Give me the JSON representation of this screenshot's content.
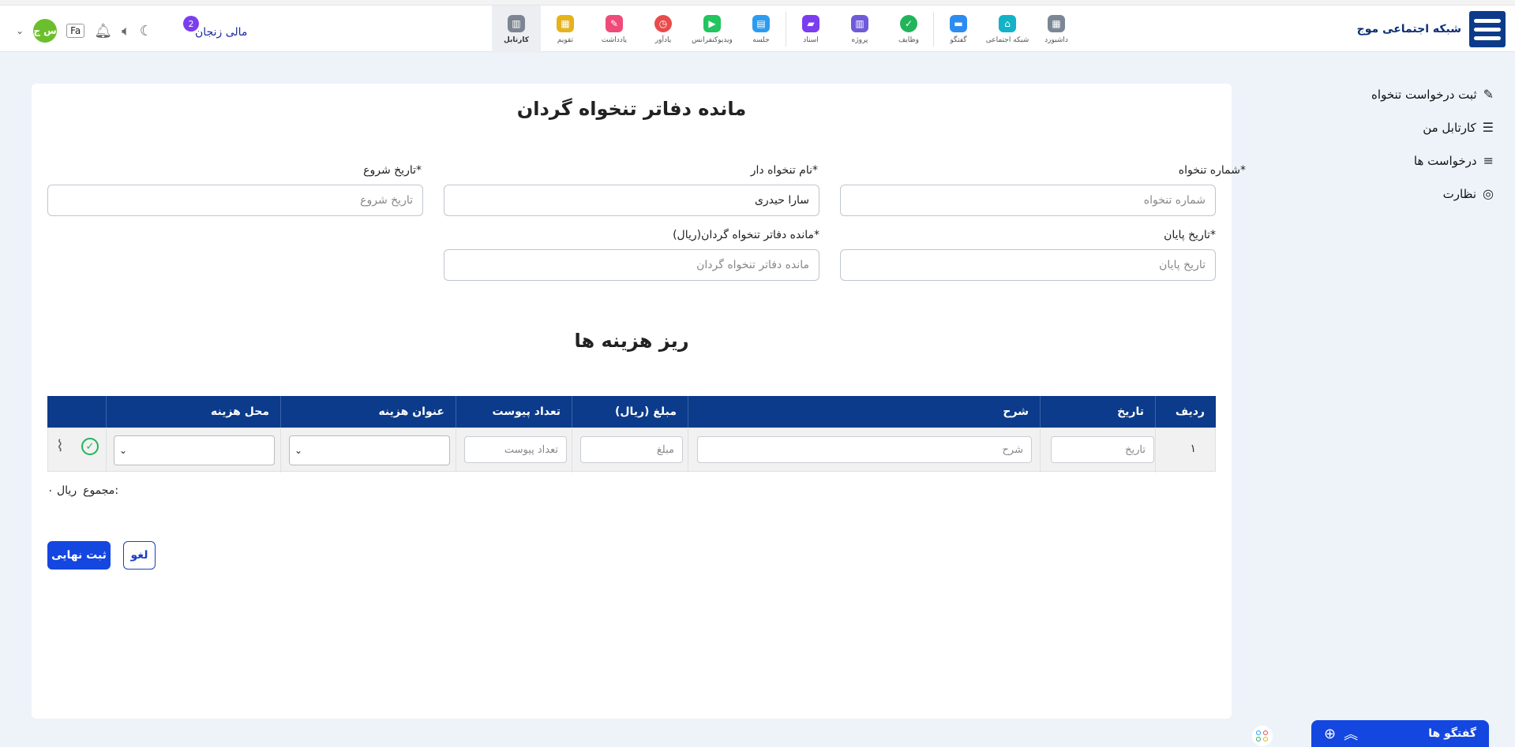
{
  "header": {
    "brand_name": "شبکه اجتماعی موج",
    "username": "مالی زنجان",
    "badge_count": "2",
    "avatar_initials": "س ج",
    "lang": "Fa",
    "apps": [
      {
        "label": "داشبورد",
        "color": "#7b8794"
      },
      {
        "label": "شبکه اجتماعی",
        "color": "#12b3c7"
      },
      {
        "label": "گفتگو",
        "color": "#2d8cf0"
      },
      {
        "label": "وظایف",
        "color": "#22b45a"
      },
      {
        "label": "پروژه",
        "color": "#6f5bd9"
      },
      {
        "label": "اسناد",
        "color": "#7b3df0"
      },
      {
        "label": "جلسه",
        "color": "#2d9cf0"
      },
      {
        "label": "ویدیوکنفرانس",
        "color": "#22c55e"
      },
      {
        "label": "یادآور",
        "color": "#e94b4b"
      },
      {
        "label": "یادداشت",
        "color": "#ef4b7a"
      },
      {
        "label": "تقویم",
        "color": "#e5b21a"
      },
      {
        "label": "کارتابل",
        "color": "#7c8591"
      }
    ]
  },
  "sidebar": {
    "items": [
      {
        "label": "ثبت درخواست تنخواه",
        "icon": "edit-icon"
      },
      {
        "label": "کارتابل من",
        "icon": "user-list-icon"
      },
      {
        "label": "درخواست ها",
        "icon": "menu-icon"
      },
      {
        "label": "نظارت",
        "icon": "user-gear-icon"
      }
    ]
  },
  "form": {
    "title": "مانده دفاتر تنخواه گردان",
    "fund_number_label": "شماره تنخواه*",
    "fund_number_placeholder": "شماره تنخواه",
    "holder_name_label": "نام تنخواه دار*",
    "holder_name_value": "سارا حیدری",
    "start_date_label": "تاریخ شروع*",
    "start_date_placeholder": "تاریخ شروع",
    "end_date_label": "تاریخ پایان*",
    "end_date_placeholder": "تاریخ پایان",
    "balance_label": "مانده دفاتر تنخواه گردان(ریال)*",
    "balance_placeholder": "مانده دفاتر تنخواه گردان"
  },
  "expenses": {
    "title": "ریز هزینه ها",
    "columns": [
      "ردیف",
      "تاریخ",
      "شرح",
      "مبلغ (ریال)",
      "تعداد پیوست",
      "عنوان هزینه",
      "محل هزینه"
    ],
    "row": {
      "index": "۱",
      "date_placeholder": "تاریخ",
      "desc_placeholder": "شرح",
      "amount_placeholder": "مبلغ",
      "attachments_placeholder": "تعداد پیوست"
    },
    "total_label": "مجموع:",
    "total_value": "۰ ریال"
  },
  "actions": {
    "submit": "ثبت نهایی",
    "cancel": "لغو"
  },
  "chat": {
    "title": "گفتگو ها"
  }
}
